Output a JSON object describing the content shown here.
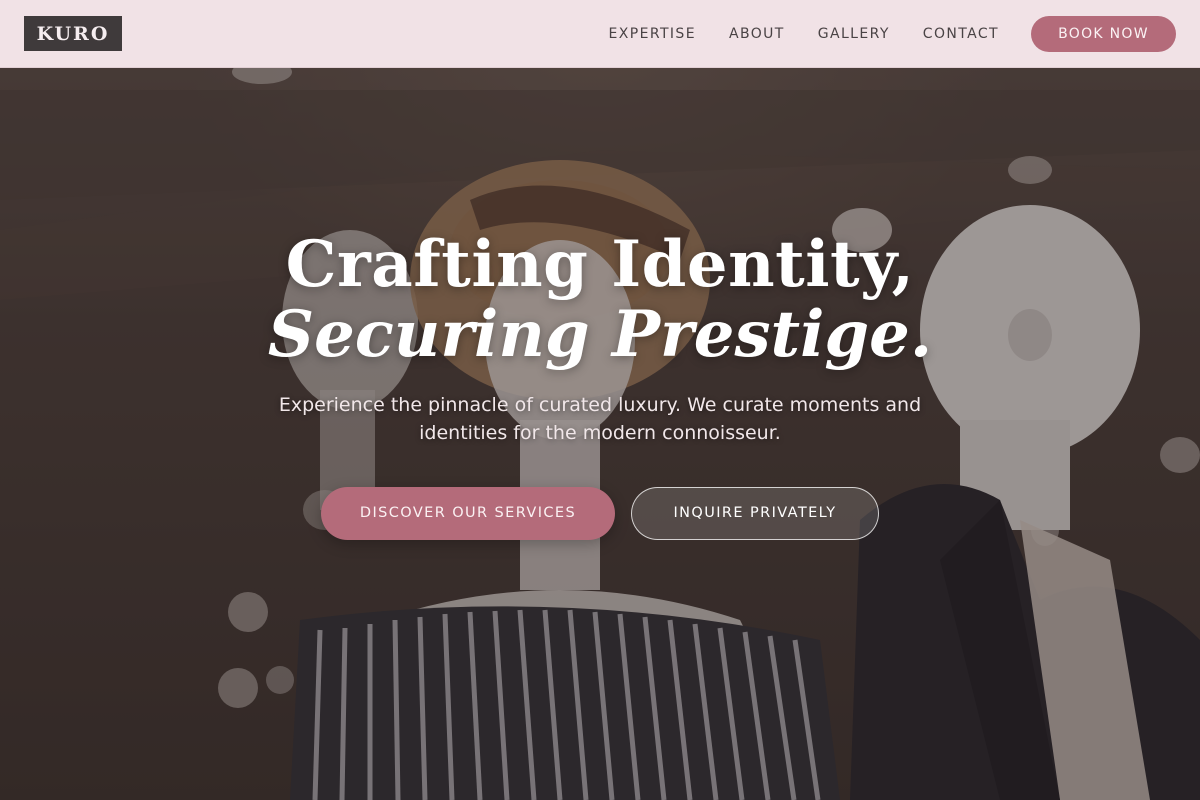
{
  "header": {
    "logo": "KURO",
    "nav": [
      "EXPERTISE",
      "ABOUT",
      "GALLERY",
      "CONTACT"
    ],
    "book_label": "BOOK NOW"
  },
  "hero": {
    "headline_line1": "Crafting Identity,",
    "headline_line2": "Securing Prestige.",
    "subtitle": "Experience the pinnacle of curated luxury. We curate moments and identities for the modern connoisseur.",
    "primary_cta": "DISCOVER OUR SERVICES",
    "secondary_cta": "INQUIRE PRIVATELY",
    "background_image": "mannequins-boutique-photo"
  },
  "colors": {
    "header_bg": "#f1e2e6",
    "logo_bg": "#3f3a3b",
    "accent": "#b46b7a",
    "nav_text": "#4a4345"
  }
}
